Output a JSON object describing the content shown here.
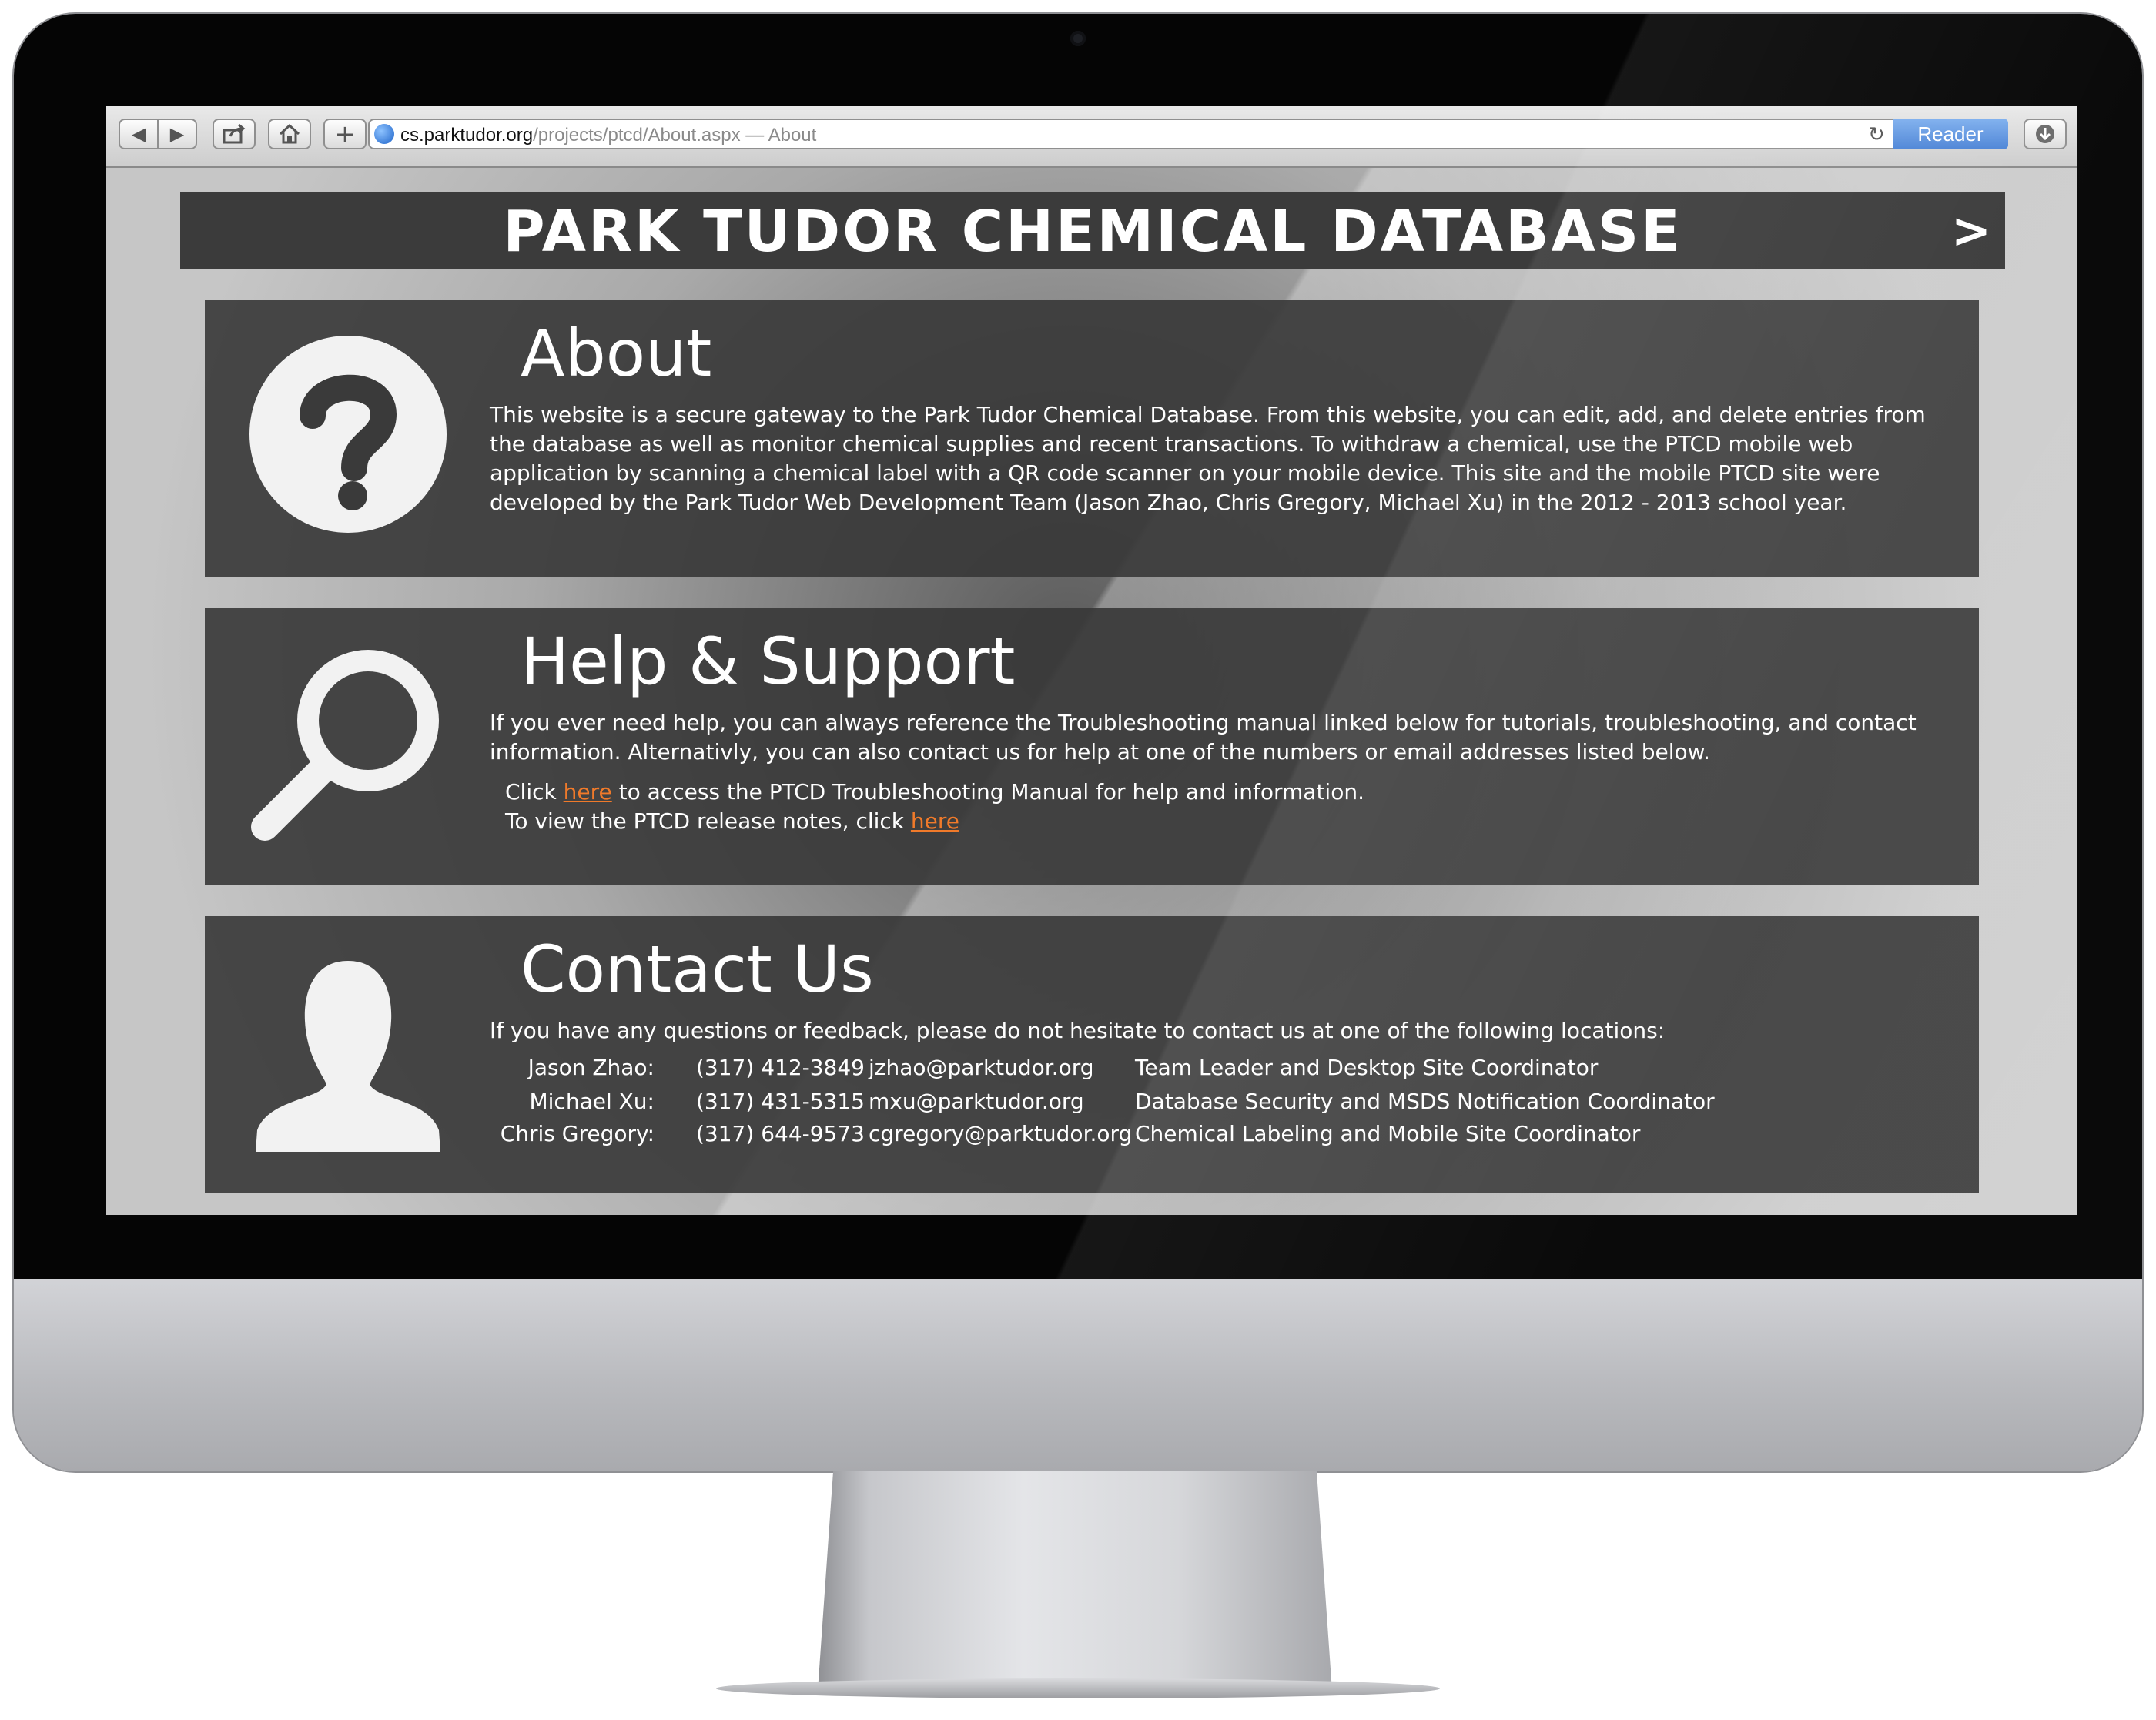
{
  "browser": {
    "url_host": "cs.parktudor.org",
    "url_path": "/projects/ptcd/About.aspx — About",
    "reader_label": "Reader"
  },
  "banner": {
    "title": "PARK TUDOR CHEMICAL DATABASE",
    "arrow": ">"
  },
  "about": {
    "title": "About",
    "text": "This website is a secure gateway to the Park Tudor Chemical Database. From this website, you can edit, add, and delete entries from the database as well as monitor chemical supplies and recent transactions. To withdraw a chemical, use the PTCD mobile web application by scanning a chemical label with a QR code scanner on your mobile device. This site and the mobile PTCD site were developed by the Park Tudor Web Development Team (Jason Zhao, Chris Gregory, Michael Xu) in the 2012 - 2013 school year."
  },
  "help": {
    "title": "Help & Support",
    "text": "If you ever need help, you can always reference the Troubleshooting manual linked below for tutorials, troubleshooting, and contact information. Alternativly, you can also contact us for help at one of the numbers or email addresses listed below.",
    "manual_prefix": "Click ",
    "manual_link": "here",
    "manual_suffix": " to access the PTCD Troubleshooting Manual for help and information.",
    "notes_prefix": "To view the PTCD release notes, click ",
    "notes_link": "here"
  },
  "contact": {
    "title": "Contact Us",
    "text": "If you have any questions or feedback, please do not hesitate to contact us at one of the following locations:",
    "people": [
      {
        "name": "Jason Zhao:",
        "phone": "(317) 412-3849",
        "email": "jzhao@parktudor.org",
        "role": "Team Leader and Desktop Site Coordinator"
      },
      {
        "name": "Michael Xu:",
        "phone": "(317) 431-5315",
        "email": "mxu@parktudor.org",
        "role": "Database Security and MSDS Notification Coordinator"
      },
      {
        "name": "Chris Gregory:",
        "phone": "(317) 644-9573",
        "email": "cgregory@parktudor.org",
        "role": "Chemical Labeling and Mobile Site Coordinator"
      }
    ]
  },
  "icons": {
    "about": "question-circle-icon",
    "help": "magnifier-icon",
    "contact": "person-silhouette-icon"
  }
}
